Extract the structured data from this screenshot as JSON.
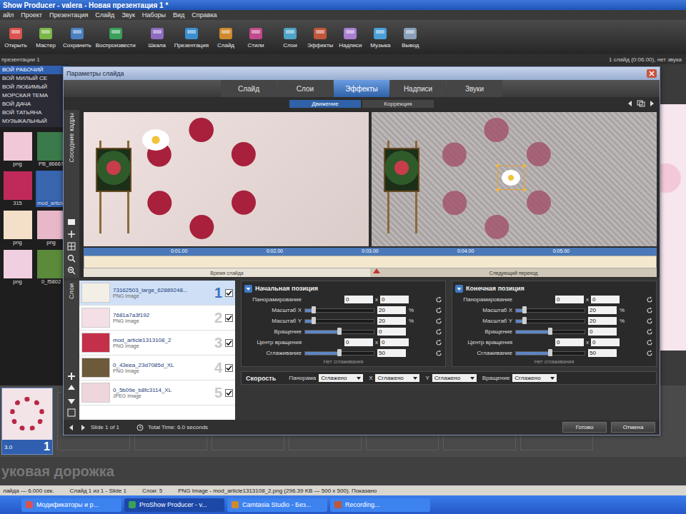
{
  "window": {
    "title": "Show Producer - valera - Новая презентация 1 *"
  },
  "menu": [
    "айл",
    "Проект",
    "Презентация",
    "Слайд",
    "Звук",
    "Наборы",
    "Вид",
    "Справка"
  ],
  "toolbar": [
    {
      "label": "Открыть"
    },
    {
      "label": "Мастер"
    },
    {
      "label": "Сохранить"
    },
    {
      "label": "Воспроизвести"
    },
    {
      "label": "Шкала"
    },
    {
      "label": "Презентация"
    },
    {
      "label": "Слайд"
    },
    {
      "label": "Стили"
    },
    {
      "label": "Слои"
    },
    {
      "label": "Эффекты"
    },
    {
      "label": "Надписи"
    },
    {
      "label": "Музыка"
    },
    {
      "label": "Вывод"
    }
  ],
  "subheader": {
    "left": "презентации 1",
    "right": "1 слайд (0:06.00), нет звука"
  },
  "sidebar": {
    "items": [
      {
        "label": "ВОЙ РАБОЧИЙ",
        "selected": true
      },
      {
        "label": "ВОЙ МИЛЫЙ СЕ",
        "selected": false
      },
      {
        "label": "ВОЙ ЛЮБИМЫЙ",
        "selected": false
      },
      {
        "label": "МОРСКАЯ ТЕМА",
        "selected": false
      },
      {
        "label": "ВОЙ ДАЧА",
        "selected": false
      },
      {
        "label": "ВОЙ ТАТЬЯНА",
        "selected": false
      },
      {
        "label": "МУЗЫКАЛЬНЫЙ",
        "selected": false
      }
    ],
    "thumbnails": [
      {
        "label": "png",
        "selected": false
      },
      {
        "label": "PB_86667",
        "selected": false
      },
      {
        "label": "315",
        "selected": false
      },
      {
        "label": "mod_article",
        "selected": true
      },
      {
        "label": "png",
        "selected": false
      },
      {
        "label": "png",
        "selected": false
      },
      {
        "label": "png",
        "selected": false
      },
      {
        "label": "0_f5802",
        "selected": false
      }
    ]
  },
  "dialog": {
    "title": "Параметры слайда",
    "tabs": [
      {
        "label": "Слайд",
        "selected": false
      },
      {
        "label": "Слои",
        "selected": false
      },
      {
        "label": "Эффекты",
        "selected": true
      },
      {
        "label": "Надписи",
        "selected": false
      },
      {
        "label": "Звуки",
        "selected": false
      }
    ],
    "subtabs": [
      {
        "label": "Движение",
        "selected": true
      },
      {
        "label": "Коррекция",
        "selected": false
      }
    ],
    "preview": {
      "side_label": "Соседние кадры",
      "ticks": [
        "0:01.00",
        "0:02.00",
        "0:03.00",
        "0:04.00",
        "0:05.00"
      ],
      "slide_time": "Время слайда",
      "next_transition": "Следующий переход"
    },
    "layers": {
      "label": "Слои",
      "items": [
        {
          "name": "73162503_large_62889248...",
          "type": "PNG Image",
          "number": "1",
          "checked": true,
          "selected": true
        },
        {
          "name": "7681a7a3f192",
          "type": "PNG Image",
          "number": "2",
          "checked": true,
          "selected": false
        },
        {
          "name": "mod_article1313108_2",
          "type": "PNG Image",
          "number": "3",
          "checked": true,
          "selected": false
        },
        {
          "name": "0_43eea_23d7085d_XL",
          "type": "PNG Image",
          "number": "4",
          "checked": true,
          "selected": false
        },
        {
          "name": "0_5b09e_b8fc3114_XL",
          "type": "JPEG Image",
          "number": "5",
          "checked": true,
          "selected": false
        }
      ]
    },
    "panels": [
      {
        "title": "Начальная позиция",
        "note": "Нет сглаживания",
        "rows": [
          {
            "label": "Панорамирование",
            "kind": "pair",
            "values": [
              "0",
              "0"
            ],
            "separator": "x"
          },
          {
            "label": "Масштаб X",
            "kind": "slider",
            "level": 0.12,
            "value": "20",
            "unit": "%"
          },
          {
            "label": "Масштаб Y",
            "kind": "slider",
            "level": 0.12,
            "value": "20",
            "unit": "%"
          },
          {
            "label": "Вращение",
            "kind": "slider",
            "level": 0.5,
            "value": "0"
          },
          {
            "label": "Центр вращения",
            "kind": "pair",
            "values": [
              "0",
              "0"
            ],
            "separator": "x"
          },
          {
            "label": "Сглаживание",
            "kind": "slider",
            "level": 0.5,
            "value": "50"
          }
        ]
      },
      {
        "title": "Конечная позиция",
        "note": "Нет сглаживания",
        "rows": [
          {
            "label": "Панорамирование",
            "kind": "pair",
            "values": [
              "0",
              "0"
            ],
            "separator": "x"
          },
          {
            "label": "Масштаб X",
            "kind": "slider",
            "level": 0.12,
            "value": "20",
            "unit": "%"
          },
          {
            "label": "Масштаб Y",
            "kind": "slider",
            "level": 0.12,
            "value": "20",
            "unit": "%"
          },
          {
            "label": "Вращение",
            "kind": "slider",
            "level": 0.5,
            "value": "0"
          },
          {
            "label": "Центр вращения",
            "kind": "pair",
            "values": [
              "0",
              "0"
            ],
            "separator": "x"
          },
          {
            "label": "Сглаживание",
            "kind": "slider",
            "level": 0.5,
            "value": "50"
          }
        ]
      }
    ],
    "speed": {
      "label": "Скорость",
      "fields": [
        {
          "label": "Панорама",
          "value": "Сглажено"
        },
        {
          "label": "X",
          "value": "Сглажено"
        },
        {
          "label": "Y",
          "value": "Сглажено"
        },
        {
          "label": "Вращение",
          "value": "Сглажено"
        }
      ]
    },
    "footer": {
      "slide": "Slide 1 of 1",
      "total": "Total Time: 6.0 seconds"
    },
    "buttons": [
      "Готово",
      "Отмена"
    ]
  },
  "slide_strip": {
    "number": "1",
    "duration": "3.0"
  },
  "soundtrack": "уковая дорожка",
  "status_bar": [
    "лайда — 6.000 сек.",
    "Слайд 1 из 1 - Slide 1",
    "Слои: 5",
    "PNG Image - mod_article1313108_2.png (296.39 KB — 500 x 500). Показано"
  ],
  "taskbar": [
    {
      "label": "Модификаторы и р...",
      "selected": false
    },
    {
      "label": "ProShow Producer - v...",
      "selected": true
    },
    {
      "label": "Camtasia Studio - Без...",
      "selected": false
    },
    {
      "label": "Recording...",
      "selected": false
    }
  ]
}
